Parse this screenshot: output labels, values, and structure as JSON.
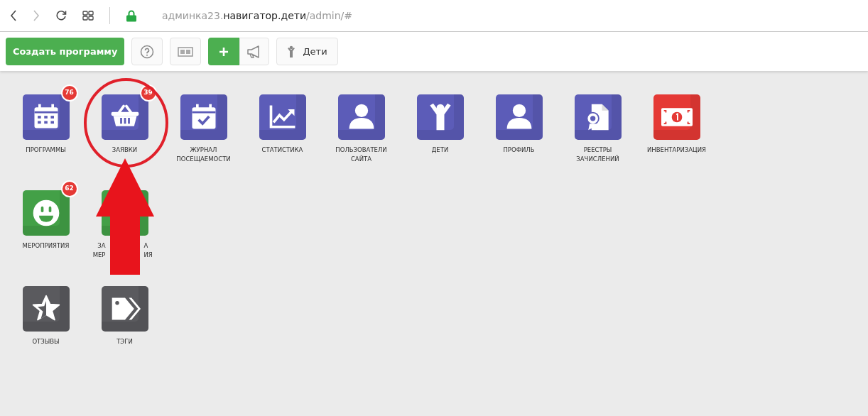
{
  "browser": {
    "url": {
      "subdomain": "админка23.",
      "host": "навигатор.дети",
      "path": "/admin/#"
    }
  },
  "toolbar": {
    "create_button": "Создать программу",
    "children_button": "Дети"
  },
  "tile_rows": [
    [
      {
        "kind": "calendar",
        "color": "#5c5cb8",
        "badge": "76",
        "label_lines": [
          [
            "ПРОГРАММЫ"
          ]
        ],
        "highlighted": false
      },
      {
        "kind": "basket",
        "color": "#5c5cb8",
        "badge": "39",
        "label_lines": [
          [
            "ЗАЯВКИ"
          ]
        ],
        "highlighted": true
      },
      {
        "kind": "calendar-check",
        "color": "#5c5cb8",
        "label_lines": [
          [
            "ЖУРНАЛ"
          ],
          [
            "ПОСЕЩАЕМОСТИ"
          ]
        ],
        "highlighted": false
      },
      {
        "kind": "chart",
        "color": "#5c5cb8",
        "label_lines": [
          [
            "СТАТИСТИКА"
          ]
        ],
        "highlighted": false
      },
      {
        "kind": "user",
        "color": "#5c5cb8",
        "label_lines": [
          [
            "ПОЛЬЗОВАТЕЛИ"
          ],
          [
            "САЙТА"
          ]
        ],
        "highlighted": false
      },
      {
        "kind": "child",
        "color": "#5c5cb8",
        "label_lines": [
          [
            "ДЕТИ"
          ]
        ],
        "highlighted": false
      },
      {
        "kind": "user",
        "color": "#5c5cb8",
        "label_lines": [
          [
            "ПРОФИЛЬ"
          ]
        ],
        "highlighted": false
      },
      {
        "kind": "certificate",
        "color": "#5c5cb8",
        "label_lines": [
          [
            "РЕЕСТРЫ"
          ],
          [
            "ЗАЧИСЛЕНИЙ"
          ]
        ],
        "highlighted": false
      },
      {
        "kind": "banknote",
        "color": "#e53935",
        "label_lines": [
          [
            "ИНВЕНТАРИЗАЦИЯ"
          ]
        ],
        "highlighted": false
      }
    ],
    [
      {
        "kind": "smiley",
        "color": "#43a047",
        "badge": "62",
        "label_lines": [
          [
            "МЕРОПРИЯТИЯ"
          ]
        ],
        "highlighted": false
      },
      {
        "color": "#43a047",
        "label_lines": [
          [
            "ЗА",
            "А"
          ],
          [
            "МЕР",
            "ИЯ"
          ]
        ],
        "highlighted": false
      }
    ],
    [
      {
        "kind": "star",
        "color": "#5a5a5e",
        "label_lines": [
          [
            "ОТЗЫВЫ"
          ]
        ],
        "highlighted": false
      },
      {
        "kind": "tags",
        "color": "#5a5a5e",
        "label_lines": [
          [
            "ТЭГИ"
          ]
        ],
        "highlighted": false
      }
    ]
  ]
}
